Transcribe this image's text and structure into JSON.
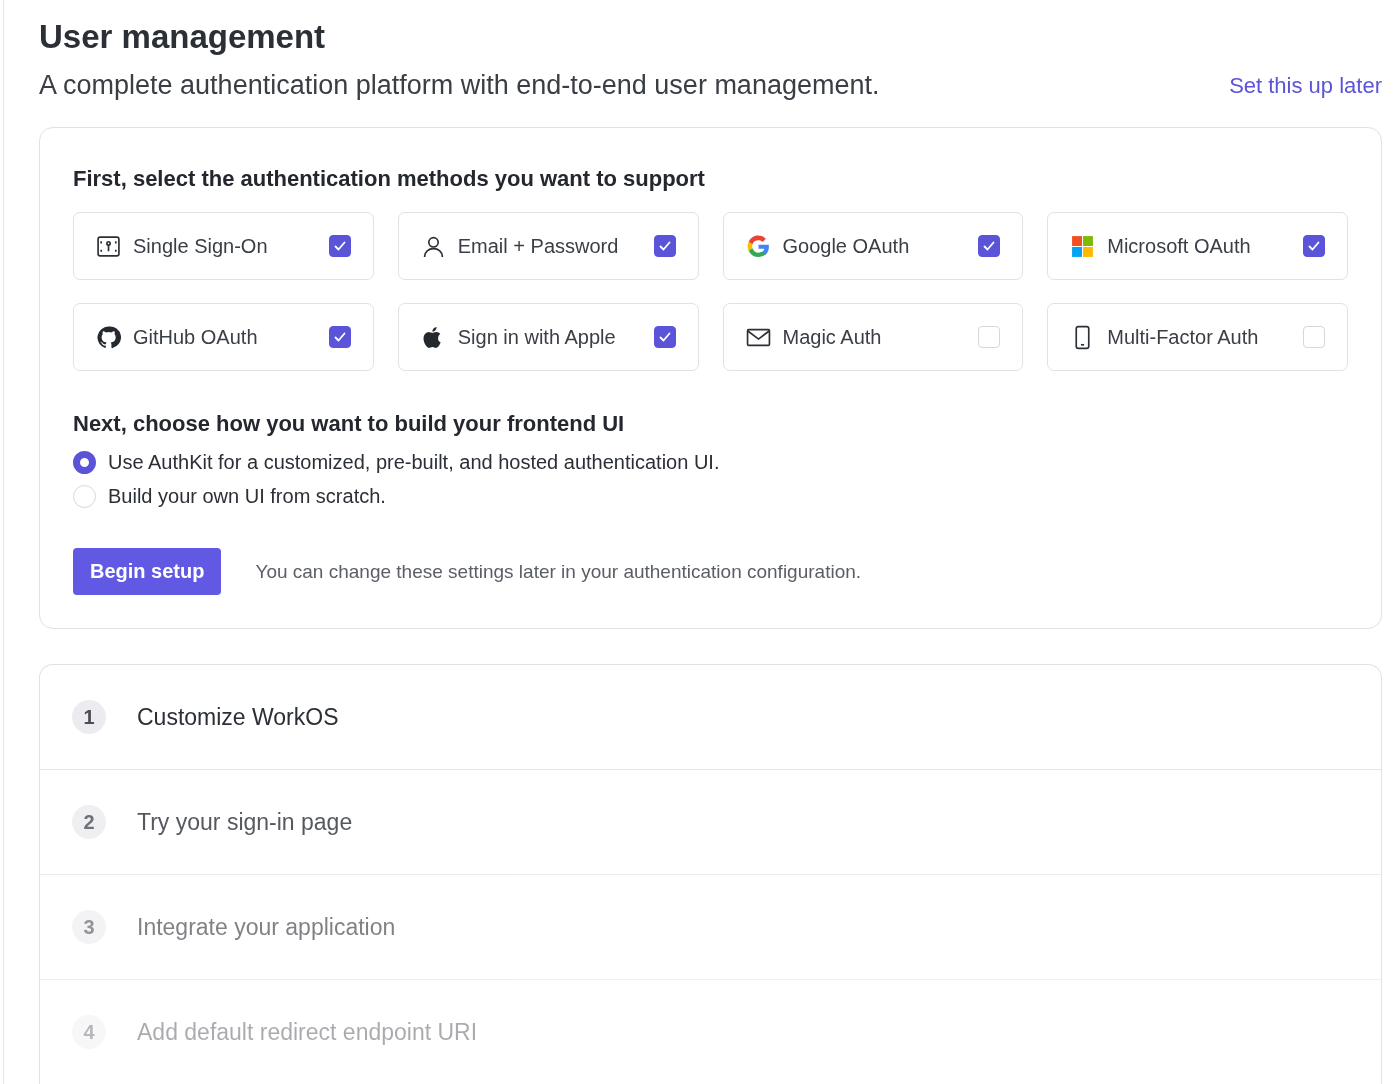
{
  "header": {
    "title": "User management",
    "subtitle": "A complete authentication platform with end-to-end user management.",
    "link": "Set this up later"
  },
  "methods": {
    "heading": "First, select the authentication methods you want to support",
    "options": [
      {
        "kind": "sso",
        "label": "Single Sign-On",
        "checked": true
      },
      {
        "kind": "user",
        "label": "Email + Password",
        "checked": true
      },
      {
        "kind": "google",
        "label": "Google OAuth",
        "checked": true
      },
      {
        "kind": "microsoft",
        "label": "Microsoft OAuth",
        "checked": true
      },
      {
        "kind": "github",
        "label": "GitHub OAuth",
        "checked": true
      },
      {
        "kind": "apple",
        "label": "Sign in with Apple",
        "checked": true
      },
      {
        "kind": "mail",
        "label": "Magic Auth",
        "checked": false
      },
      {
        "kind": "phone",
        "label": "Multi-Factor Auth",
        "checked": false
      }
    ]
  },
  "frontend": {
    "heading": "Next, choose how you want to build your frontend UI",
    "choices": [
      {
        "label": "Use AuthKit for a customized, pre-built, and hosted authentication UI.",
        "selected": true
      },
      {
        "label": "Build your own UI from scratch.",
        "selected": false
      }
    ]
  },
  "setup": {
    "button": "Begin setup",
    "note": "You can change these settings later in your authentication configuration."
  },
  "steps": [
    {
      "number": "1",
      "label": "Customize WorkOS"
    },
    {
      "number": "2",
      "label": "Try your sign-in page"
    },
    {
      "number": "3",
      "label": "Integrate your application"
    },
    {
      "number": "4",
      "label": "Add default redirect endpoint URI"
    }
  ]
}
